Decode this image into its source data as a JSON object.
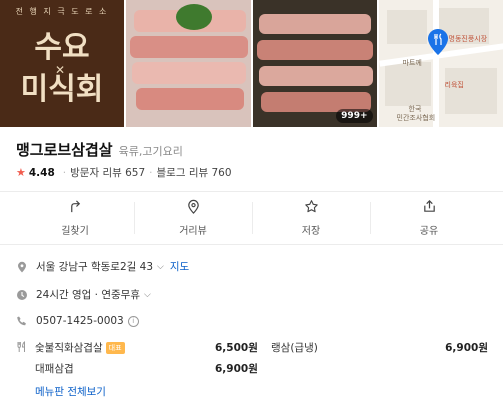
{
  "photos": {
    "logo_ring_text": "전 행 지 극 도 로 소",
    "logo_line1": "수요",
    "logo_line2": "미식회",
    "photo_count_badge": "999+",
    "map_labels": [
      "명동진풍시장",
      "마트께",
      "리육집",
      "한국",
      "민간조사협회"
    ]
  },
  "place": {
    "name": "맹그로브삼겹살",
    "category": "육류,고기요리",
    "rating": "4.48",
    "visitor_reviews": "방문자 리뷰 657",
    "blog_reviews": "블로그 리뷰 760"
  },
  "actions": [
    {
      "label": "길찾기",
      "icon": "directions-icon"
    },
    {
      "label": "거리뷰",
      "icon": "location-pin-icon"
    },
    {
      "label": "저장",
      "icon": "star-outline-icon"
    },
    {
      "label": "공유",
      "icon": "share-icon"
    }
  ],
  "info": {
    "address": "서울 강남구 학동로2길 43",
    "map_link": "지도",
    "hours": "24시간 영업 · 연중무휴",
    "phone": "0507-1425-0003"
  },
  "menu": {
    "items": [
      {
        "name": "숯불직화삼겹살",
        "tag": "대표",
        "price": "6,500원"
      },
      {
        "name": "랭삼(급냉)",
        "price": "6,900원"
      },
      {
        "name": "대패삼겹",
        "price": "6,900원"
      }
    ],
    "more_link": "메뉴판 전체보기"
  },
  "colors": {
    "accent_star": "#f15c4e",
    "link": "#0a5fc8",
    "menu_tag": "#ffb84d"
  }
}
